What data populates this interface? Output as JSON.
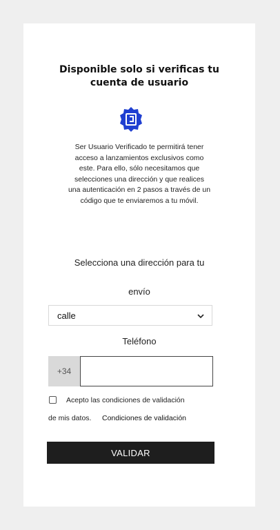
{
  "modal": {
    "title_line1": "Disponible solo si verificas tu",
    "title_line2": "cuenta de usuario",
    "badge_icon": "verified-user-badge-icon",
    "description_lines": [
      "Ser Usuario Verificado te permitirá tener",
      "acceso a lanzamientos exclusivos como",
      "este. Para ello, sólo necesitamos que",
      "selecciones una dirección y que realices",
      "una autenticación en 2 pasos a través de un",
      "código que te enviaremos a tu móvil."
    ],
    "address_label_line1": "Selecciona una dirección para tu",
    "address_label_line2": "envío",
    "address_select_value": "calle",
    "phone_label": "Teléfono",
    "phone_prefix": "+34",
    "phone_value": "",
    "consent_line1": "Acepto las condiciones de validación",
    "consent_line2": "de mis datos.",
    "consent_link": "Condiciones de validación",
    "consent_checked": false,
    "submit_label": "VALIDAR"
  },
  "colors": {
    "page_background": "#efefef",
    "card_background": "#ffffff",
    "badge_blue": "#1f3fd1",
    "button_background": "#1e1e1e",
    "prefix_background": "#d9d9d9"
  }
}
